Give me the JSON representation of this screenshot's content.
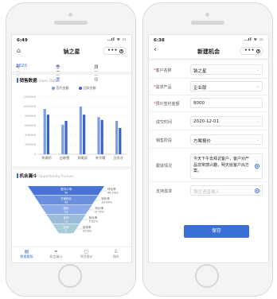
{
  "left": {
    "status": {
      "time": "6:49",
      "signal": "..ıl ᯤ ▭"
    },
    "nav": {
      "title": "钠之星",
      "dots": "•••"
    },
    "filters": {
      "year_label": "年份:",
      "year_value": "2020",
      "season_label": "季度:",
      "season_value": "一季度",
      "month_label": "月份:",
      "month_value": "请选择"
    },
    "sales": {
      "title": "销售数据",
      "subtitle": "Sales Data"
    },
    "funnel_section": {
      "title": "机会漏斗",
      "subtitle": "Opportunity Funnel"
    },
    "tabs": [
      {
        "label": "数据看板",
        "icon": "chart-icon",
        "glyph": "▤"
      },
      {
        "label": "机会漏斗",
        "icon": "funnel-icon",
        "glyph": "⏷"
      },
      {
        "label": "项目报价",
        "icon": "quote-icon",
        "glyph": "▢"
      },
      {
        "label": "我的",
        "icon": "user-icon",
        "glyph": "♙"
      }
    ],
    "colors": {
      "accent": "#3a6fd8",
      "series1": "#7b9de8",
      "series2": "#3a62c8"
    }
  },
  "chart_data": {
    "type": "bar",
    "categories": [
      "李建明",
      "白晓慧",
      "郑美丽",
      "李大曦",
      "吕秀才"
    ],
    "series": [
      {
        "name": "签约金额",
        "values": [
          950000,
          620000,
          1000000,
          780000,
          700000
        ]
      },
      {
        "name": "回款金额",
        "values": [
          830000,
          700000,
          830000,
          720000,
          550000
        ]
      }
    ],
    "ylim": [
      0,
      1200000
    ],
    "yticks": [
      "1200000",
      "1000000",
      "800000",
      "600000",
      "400000",
      "200000",
      "0"
    ],
    "legend": "top-center"
  },
  "funnel": {
    "stages": [
      {
        "name": "意向订单",
        "value": "50"
      },
      {
        "name": "方案报价",
        "value": "33"
      },
      {
        "name": "招标",
        "value": "23"
      },
      {
        "name": "谈判",
        "value": "12"
      },
      {
        "name": "赢单",
        "value": "5"
      }
    ],
    "notes": [
      {
        "label": "转化率",
        "value": "46.23%"
      },
      {
        "label": "转化率",
        "value": "33.43%"
      },
      {
        "label": "转化率",
        "value": "8.73%"
      },
      {
        "label": "转化率",
        "value": "5.02%"
      },
      {
        "label": "赢单率",
        "value": "25.8%"
      }
    ]
  },
  "right": {
    "status": {
      "time": "6:38",
      "signal": "..ıl ᯤ ▭"
    },
    "nav": {
      "title": "新建机会",
      "back": "‹",
      "dots": "•••"
    },
    "form": {
      "customer": {
        "label": "客户名称",
        "value": "钠之星"
      },
      "product": {
        "label": "需求产品",
        "value": "企业版"
      },
      "amount": {
        "label": "预计签约金额",
        "value": "8000"
      },
      "deal_date": {
        "label": "成交时间",
        "value": "2020-12-01"
      },
      "stage": {
        "label": "销售阶段",
        "value": "方案报价"
      },
      "followup": {
        "label": "跟进情况",
        "value": "今天下午去拜访客户，客户对产品非常感兴趣，明天给客户出方案。"
      },
      "support": {
        "label": "支持需求",
        "placeholder": "按住语音输入"
      }
    },
    "save_label": "保存"
  }
}
